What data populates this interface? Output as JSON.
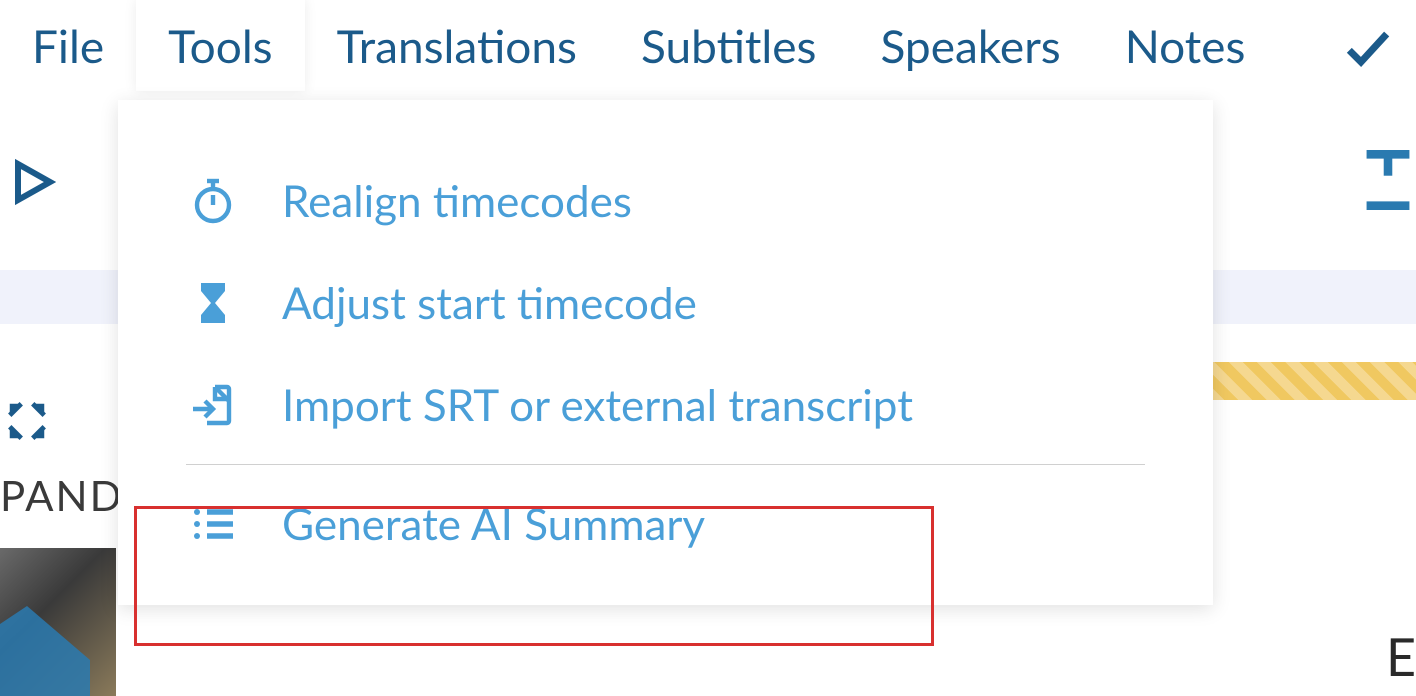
{
  "menubar": {
    "items": [
      {
        "label": "File"
      },
      {
        "label": "Tools"
      },
      {
        "label": "Translations"
      },
      {
        "label": "Subtitles"
      },
      {
        "label": "Speakers"
      },
      {
        "label": "Notes"
      }
    ]
  },
  "tools_dropdown": {
    "items": [
      {
        "label": "Realign timecodes"
      },
      {
        "label": "Adjust start timecode"
      },
      {
        "label": "Import SRT or external transcript"
      },
      {
        "label": "Generate AI Summary"
      }
    ]
  },
  "partial_text": {
    "pand": "PAND",
    "right_letter": "E"
  }
}
